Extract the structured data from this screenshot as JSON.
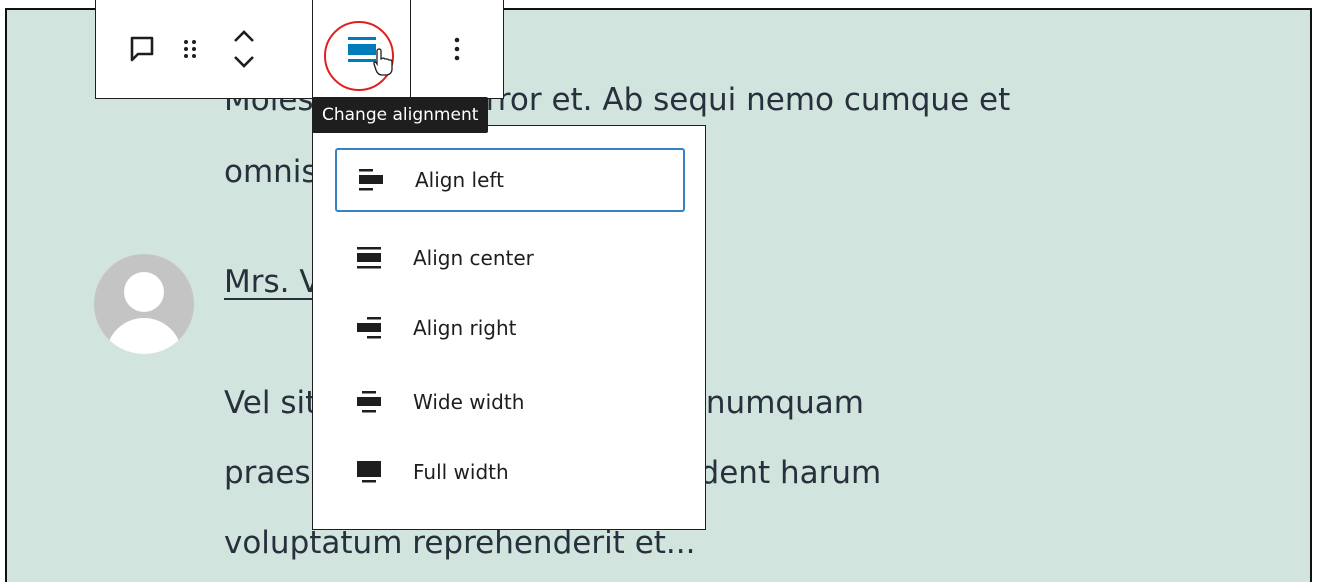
{
  "post": {
    "line1": "Molestiae quos error et. Ab sequi nemo cumque et",
    "line2": "omnis aut veroltaque ut...",
    "comment_title": "Mrs. Velit culpa",
    "body_line1": "Vel sit voluptates qui modi. Ad numquam",
    "body_line2": "praesentium accusamus. Provident harum",
    "body_line3": "voluptatum reprehenderit et..."
  },
  "toolbar": {
    "buttons": [
      {
        "name": "comment",
        "icon": "comment-icon"
      },
      {
        "name": "drag",
        "icon": "drag-handle-icon"
      },
      {
        "name": "move",
        "icon": "chevron-up-down-icon"
      },
      {
        "name": "alignment",
        "icon": "align-center-icon"
      },
      {
        "name": "options",
        "icon": "more-vertical-icon"
      }
    ],
    "accent_color": "#007cba",
    "highlight_ring_color": "#e02020"
  },
  "tooltip": {
    "text": "Change alignment"
  },
  "alignment_menu": {
    "items": [
      {
        "label": "Align left",
        "icon": "align-left-icon",
        "focused": true
      },
      {
        "label": "Align center",
        "icon": "align-center-icon",
        "focused": false
      },
      {
        "label": "Align right",
        "icon": "align-right-icon",
        "focused": false
      },
      {
        "label": "Wide width",
        "icon": "wide-width-icon",
        "focused": false
      },
      {
        "label": "Full width",
        "icon": "full-width-icon",
        "focused": false
      }
    ]
  },
  "colors": {
    "content_bg": "#d1e4dd",
    "text": "#28303d",
    "focus_border": "#3582c4"
  }
}
